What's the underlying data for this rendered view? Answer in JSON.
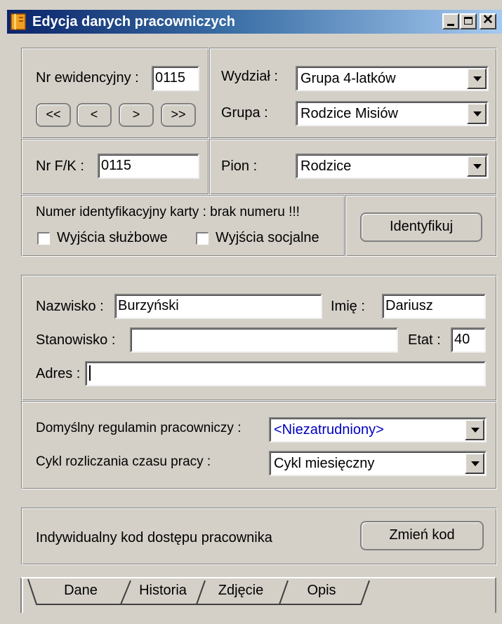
{
  "window": {
    "title": "Edycja danych pracowniczych",
    "icon": "app-doc-icon",
    "controls": [
      "minimize-icon",
      "maximize-icon",
      "close-icon"
    ]
  },
  "record": {
    "nr_ewidencyjny_label": "Nr ewidencyjny :",
    "nr_ewidencyjny_value": "0115",
    "nav": {
      "first": "<<",
      "prev": "<",
      "next": ">",
      "last": ">>"
    }
  },
  "wydzial": {
    "label": "Wydział :",
    "value": "Grupa 4-latków"
  },
  "grupa": {
    "label": "Grupa :",
    "value": "Rodzice Misiów"
  },
  "nrfk": {
    "label": "Nr F/K :",
    "value": "0115"
  },
  "pion": {
    "label": "Pion :",
    "value": "Rodzice"
  },
  "card": {
    "text": "Numer identyfikacyjny karty : brak numeru !!!",
    "wyjscia_sluzbowe": "Wyjścia służbowe",
    "wyjscia_socjalne": "Wyjścia socjalne",
    "identify_button": "Identyfikuj"
  },
  "person": {
    "nazwisko_label": "Nazwisko :",
    "nazwisko_value": "Burzyński",
    "imie_label": "Imię :",
    "imie_value": "Dariusz",
    "stanowisko_label": "Stanowisko :",
    "stanowisko_value": "",
    "etat_label": "Etat :",
    "etat_value": "40",
    "adres_label": "Adres :",
    "adres_value": ""
  },
  "rules": {
    "regulamin_label": "Domyślny regulamin pracowniczy :",
    "regulamin_value": "<Niezatrudniony>",
    "regulamin_color": "#0000c0",
    "cykl_label": "Cykl rozliczania czasu pracy :",
    "cykl_value": "Cykl miesięczny"
  },
  "access": {
    "label": "Indywidualny kod dostępu pracownika",
    "button": "Zmień kod"
  },
  "tabs": [
    {
      "label": "Dane",
      "active": true
    },
    {
      "label": "Historia",
      "active": false
    },
    {
      "label": "Zdjęcie",
      "active": false
    },
    {
      "label": "Opis",
      "active": false
    }
  ]
}
